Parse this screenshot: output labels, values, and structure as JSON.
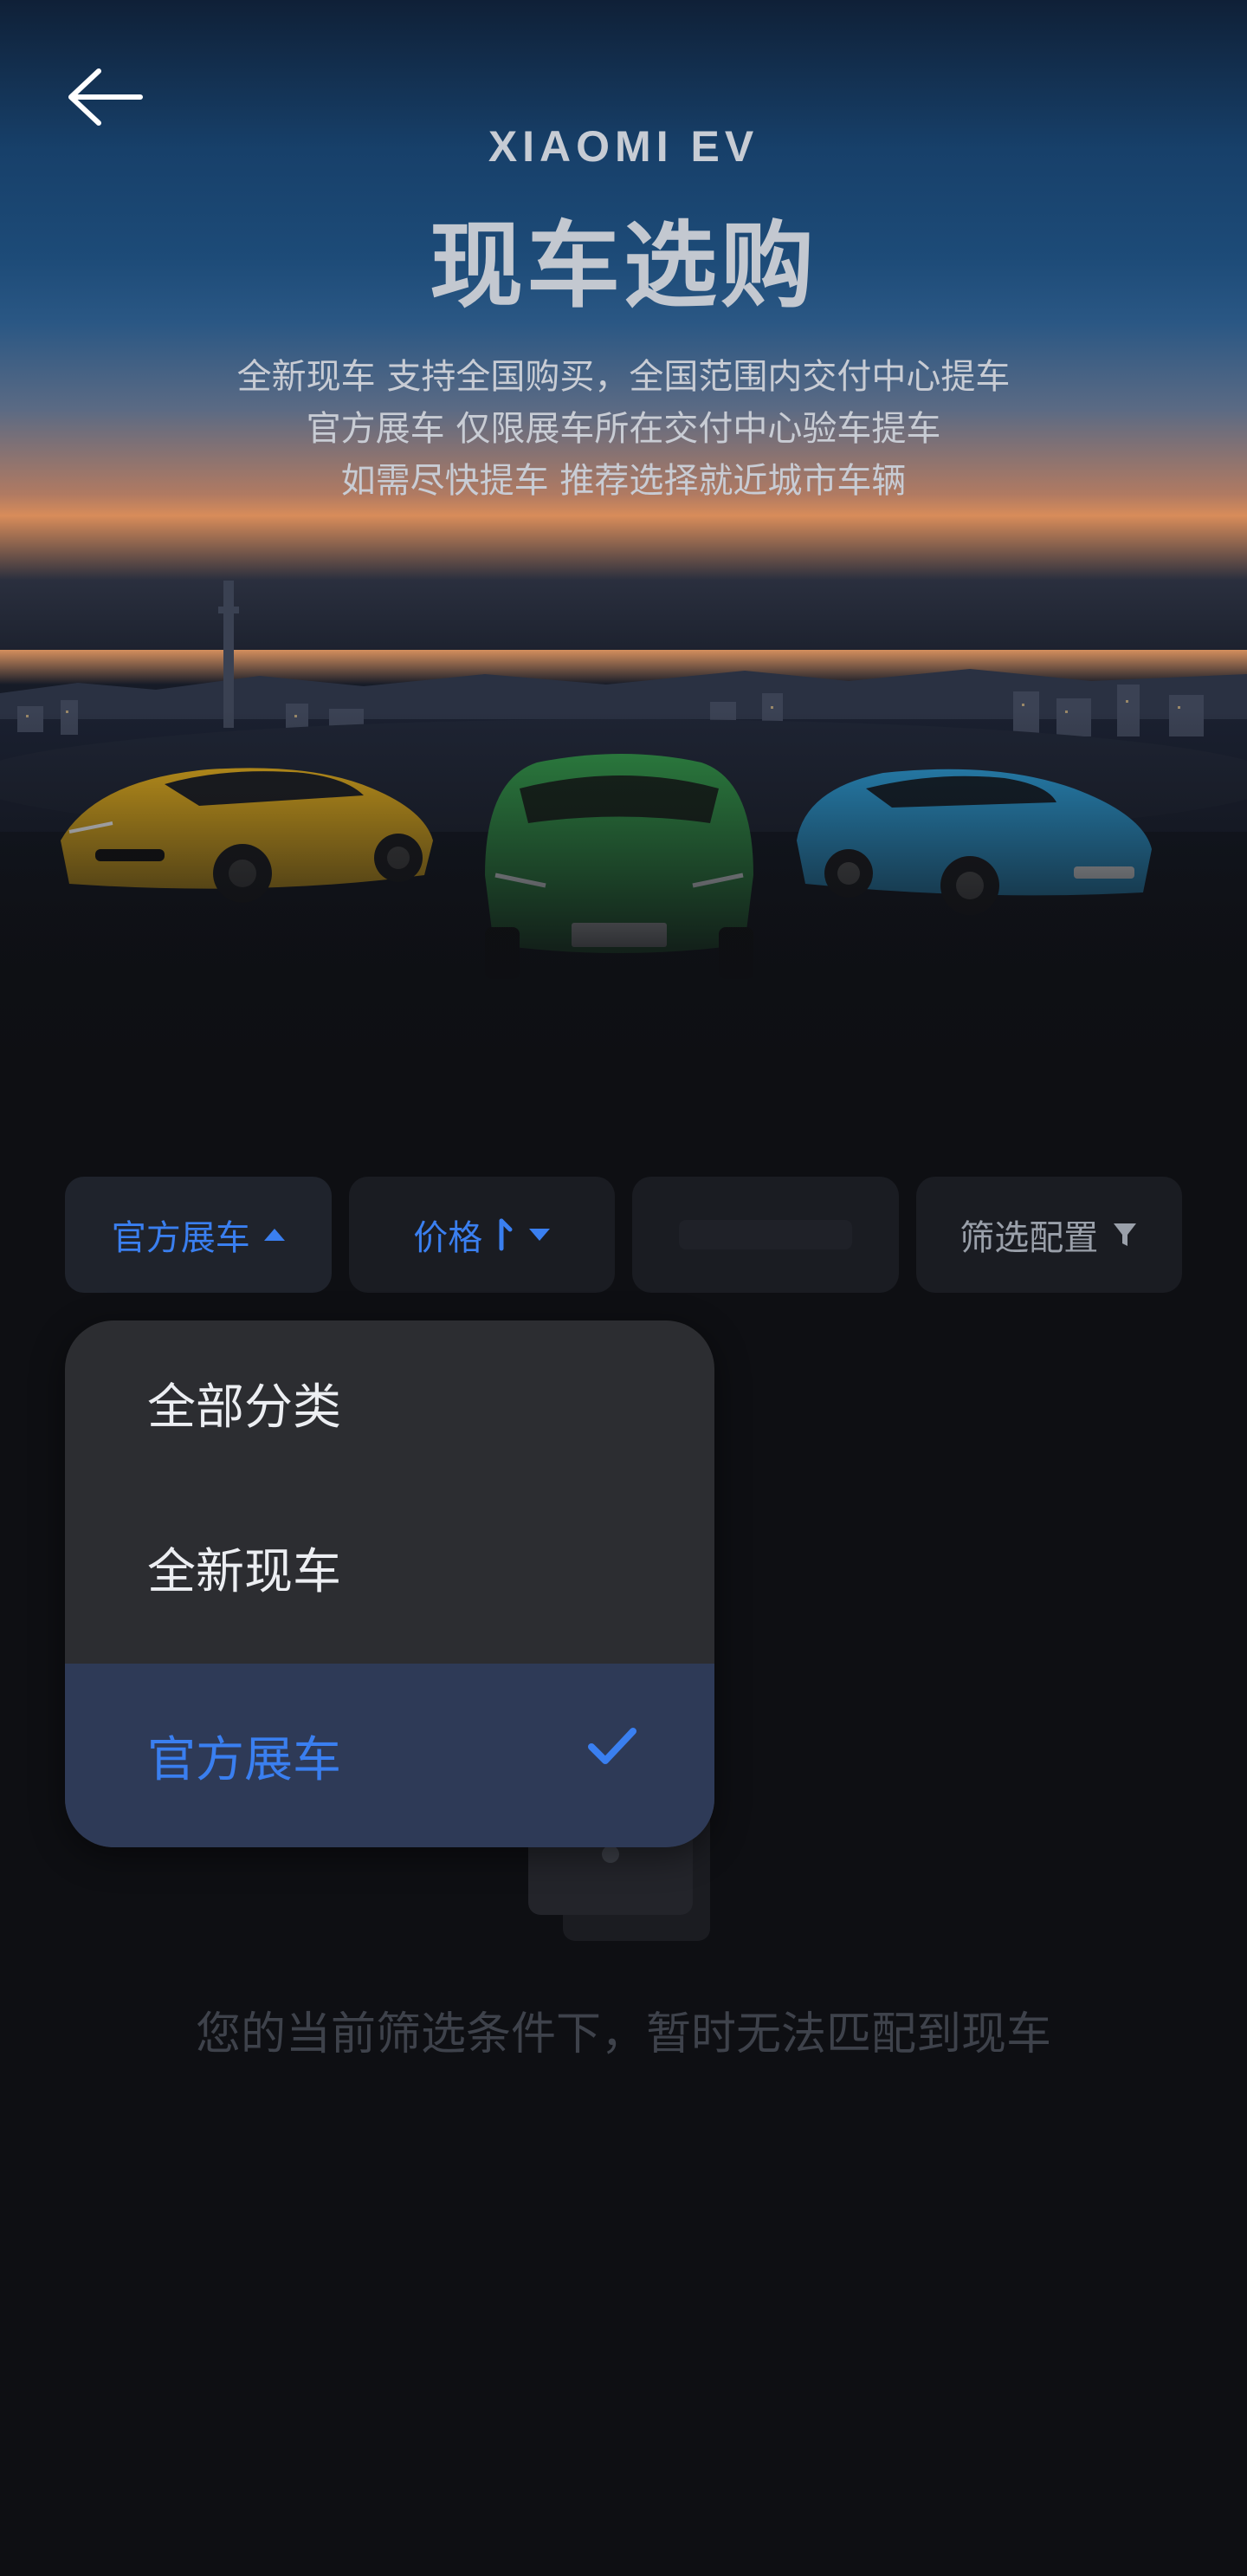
{
  "header": {
    "back_icon": "arrow-left-icon",
    "brand": "XIAOMI EV",
    "title": "现车选购",
    "subtitle_lines": [
      "全新现车 支持全国购买，全国范围内交付中心提车",
      "官方展车 仅限展车所在交付中心验车提车",
      "如需尽快提车 推荐选择就近城市车辆"
    ]
  },
  "filters": {
    "category_label": "官方展车",
    "price_label": "价格",
    "config_label": "筛选配置",
    "category_icon": "caret-up-icon",
    "price_sort_icon": "sort-icon",
    "price_icon": "caret-down-icon",
    "config_icon": "filter-funnel-icon"
  },
  "dropdown": {
    "items": [
      {
        "label": "全部分类",
        "selected": false
      },
      {
        "label": "全新现车",
        "selected": false
      },
      {
        "label": "官方展车",
        "selected": true
      }
    ],
    "check_icon": "checkmark-icon"
  },
  "empty_state": {
    "icon": "empty-box-icon",
    "message": "您的当前筛选条件下，暂时无法匹配到现车"
  },
  "colors": {
    "accent": "#3a7ff0",
    "background": "#0e0f13",
    "dropdown_bg": "#2c2d31",
    "selected_bg": "#2e3a57"
  }
}
